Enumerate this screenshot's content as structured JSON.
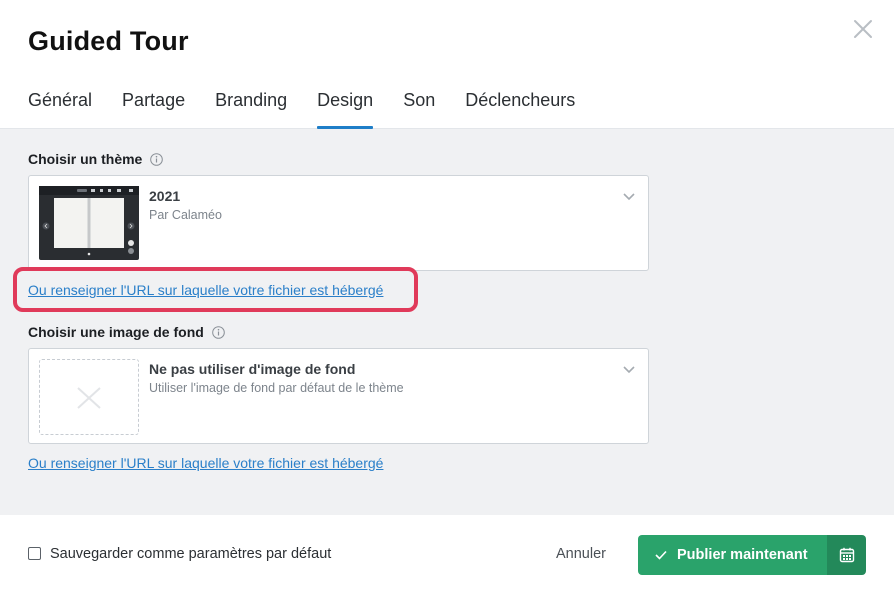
{
  "dialog": {
    "title": "Guided Tour",
    "tabs": [
      {
        "label": "Général"
      },
      {
        "label": "Partage"
      },
      {
        "label": "Branding"
      },
      {
        "label": "Design",
        "active": true
      },
      {
        "label": "Son"
      },
      {
        "label": "Déclencheurs"
      }
    ]
  },
  "theme": {
    "label": "Choisir un thème",
    "selected_name": "2021",
    "selected_author": "Par Calaméo",
    "url_link": "Ou renseigner l'URL sur laquelle votre fichier est hébergé"
  },
  "background": {
    "label": "Choisir une image de fond",
    "selected_name": "Ne pas utiliser d'image de fond",
    "selected_desc": "Utiliser l'image de fond par défaut de le thème",
    "url_link": "Ou renseigner l'URL sur laquelle votre fichier est hébergé"
  },
  "footer": {
    "save_default_label": "Sauvegarder comme paramètres par défaut",
    "save_default_checked": false,
    "cancel_label": "Annuler",
    "publish_label": "Publier maintenant"
  },
  "colors": {
    "accent": "#1e7ec8",
    "publish": "#2aa36b",
    "highlight": "#e03a5a",
    "link": "#2a7fc9"
  },
  "icons": [
    "close-icon",
    "info-icon",
    "chevron-down-icon",
    "checkmark-icon",
    "calendar-icon",
    "no-image-icon"
  ]
}
